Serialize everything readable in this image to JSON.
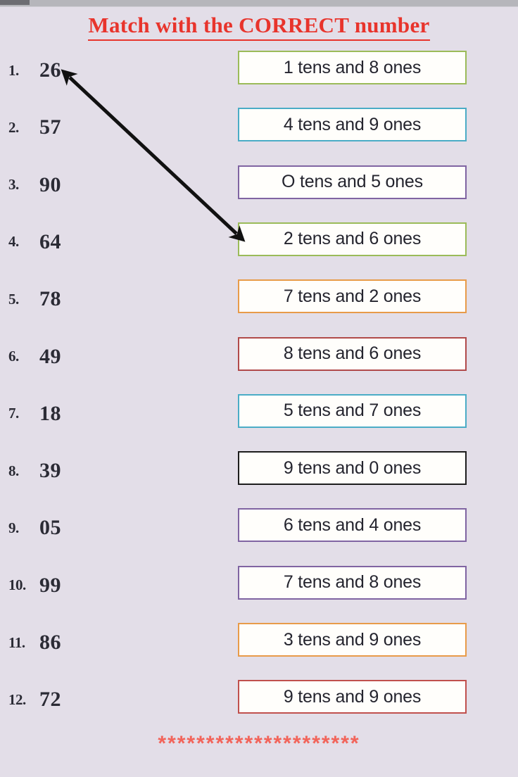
{
  "worksheet": {
    "title": "Match with the CORRECT number",
    "title_color": "#e8342c",
    "background_color": "#e3dee8",
    "divider": "*********************",
    "divider_color": "#f2645a"
  },
  "numbers": [
    {
      "index": "1.",
      "value": "26"
    },
    {
      "index": "2.",
      "value": "57"
    },
    {
      "index": "3.",
      "value": "90"
    },
    {
      "index": "4.",
      "value": "64"
    },
    {
      "index": "5.",
      "value": "78"
    },
    {
      "index": "6.",
      "value": "49"
    },
    {
      "index": "7.",
      "value": "18"
    },
    {
      "index": "8.",
      "value": "39"
    },
    {
      "index": "9.",
      "value": "05"
    },
    {
      "index": "10.",
      "value": "99"
    },
    {
      "index": "11.",
      "value": "86"
    },
    {
      "index": "12.",
      "value": "72"
    }
  ],
  "answers": [
    {
      "label": "1 tens and 8 ones",
      "border_color": "#9bbb59"
    },
    {
      "label": "4 tens and 9 ones",
      "border_color": "#4bacc6"
    },
    {
      "label": "O tens and 5 ones",
      "border_color": "#8064a2"
    },
    {
      "label": "2 tens and 6 ones",
      "border_color": "#9bbb59"
    },
    {
      "label": "7 tens and 2 ones",
      "border_color": "#e89b49"
    },
    {
      "label": "8 tens and 6 ones",
      "border_color": "#b14a4a"
    },
    {
      "label": "5 tens and 7 ones",
      "border_color": "#4bacc6"
    },
    {
      "label": "9 tens and 0 ones",
      "border_color": "#1d1d1d"
    },
    {
      "label": "6 tens and 4 ones",
      "border_color": "#8064a2"
    },
    {
      "label": "7 tens and 8 ones",
      "border_color": "#8064a2"
    },
    {
      "label": "3 tens and 9 ones",
      "border_color": "#e89b49"
    },
    {
      "label": "9 tens and 9 ones",
      "border_color": "#c0504d"
    }
  ],
  "arrow": {
    "color": "#111111",
    "from_label": "26",
    "to_label": "2 tens and 6 ones"
  }
}
